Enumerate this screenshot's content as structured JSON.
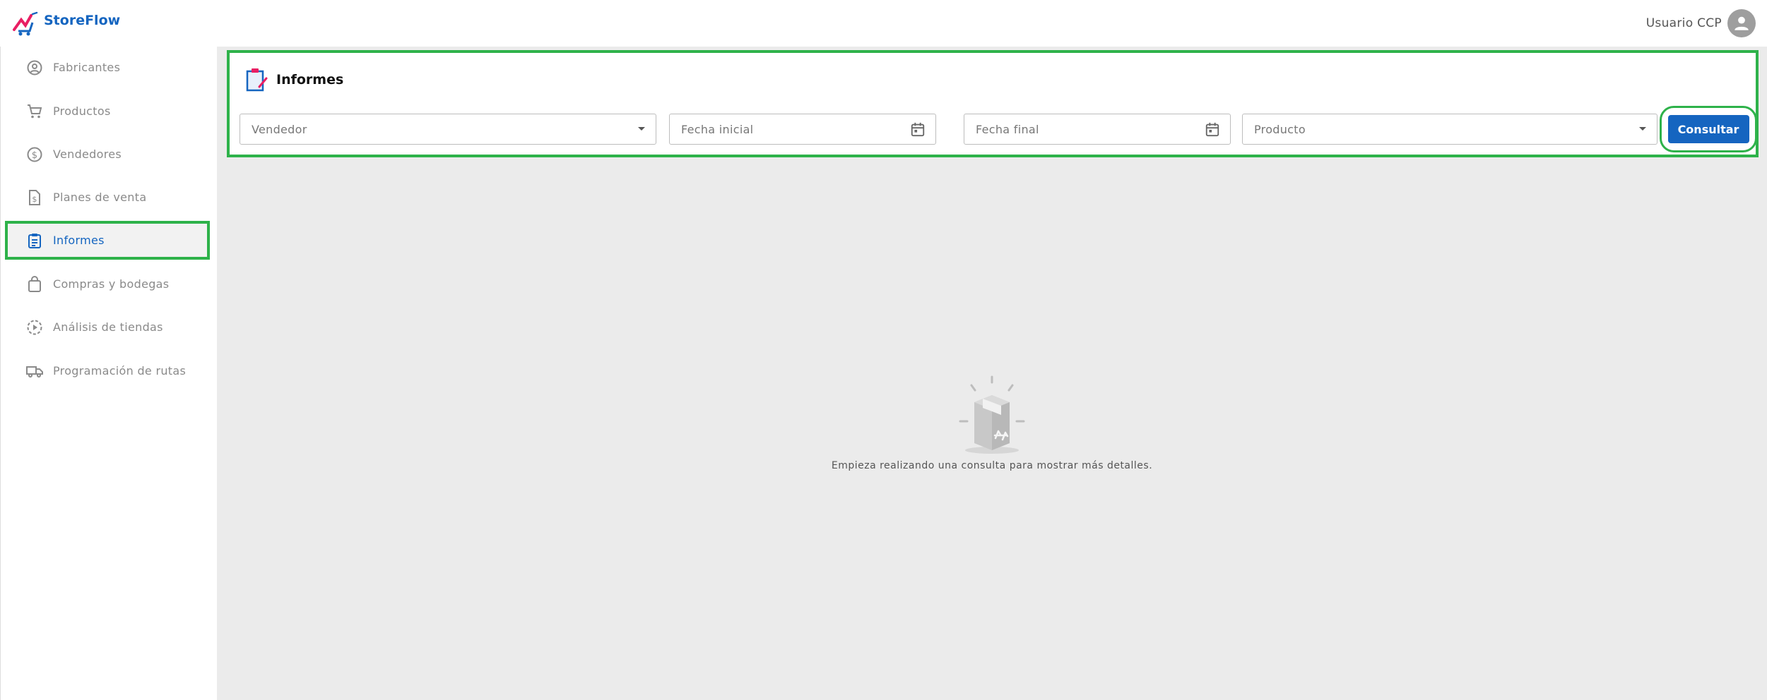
{
  "header": {
    "brand": "StoreFlow",
    "user_name": "Usuario CCP"
  },
  "sidebar": {
    "items": [
      {
        "label": "Fabricantes",
        "icon": "user-circle-icon"
      },
      {
        "label": "Productos",
        "icon": "cart-icon"
      },
      {
        "label": "Vendedores",
        "icon": "dollar-circle-icon"
      },
      {
        "label": "Planes de venta",
        "icon": "document-dollar-icon"
      },
      {
        "label": "Informes",
        "icon": "clipboard-icon",
        "active": true
      },
      {
        "label": "Compras y bodegas",
        "icon": "shopping-bag-icon"
      },
      {
        "label": "Análisis de tiendas",
        "icon": "play-circle-icon"
      },
      {
        "label": "Programación de rutas",
        "icon": "truck-icon"
      }
    ]
  },
  "main": {
    "title": "Informes",
    "filters": {
      "vendedor_placeholder": "Vendedor",
      "fecha_inicial_placeholder": "Fecha inicial",
      "fecha_final_placeholder": "Fecha final",
      "producto_placeholder": "Producto"
    },
    "submit_label": "Consultar",
    "empty_message": "Empieza realizando una consulta para mostrar más detalles."
  },
  "colors": {
    "accent": "#1565c0",
    "highlight": "#2eb24a",
    "background": "#ebebeb"
  }
}
